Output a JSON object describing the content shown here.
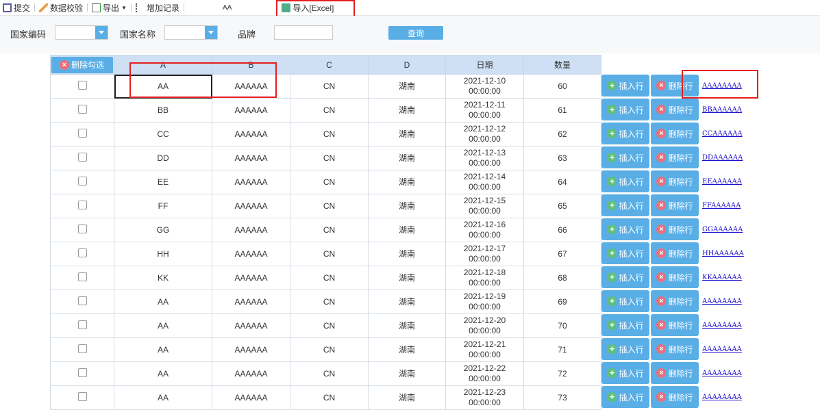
{
  "toolbar": {
    "submit": "提交",
    "validate": "数据校验",
    "export": "导出",
    "add_record": "增加记录",
    "aa": "AA",
    "import_excel": "导入[Excel]"
  },
  "filter": {
    "country_code_label": "国家编码",
    "country_name_label": "国家名称",
    "brand_label": "品牌",
    "query": "查询"
  },
  "table": {
    "delete_selected": "删除勾选",
    "columns": [
      "A",
      "B",
      "C",
      "D",
      "日期",
      "数量"
    ],
    "insert_label": "插入行",
    "delete_label": "删除行",
    "rows": [
      {
        "a": "AA",
        "b": "AAAAAA",
        "c": "CN",
        "d": "湖南",
        "date": "2021-12-10",
        "time": "00:00:00",
        "qty": "60",
        "link": "AAAAAAAA"
      },
      {
        "a": "BB",
        "b": "AAAAAA",
        "c": "CN",
        "d": "湖南",
        "date": "2021-12-11",
        "time": "00:00:00",
        "qty": "61",
        "link": "BBAAAAAA"
      },
      {
        "a": "CC",
        "b": "AAAAAA",
        "c": "CN",
        "d": "湖南",
        "date": "2021-12-12",
        "time": "00:00:00",
        "qty": "62",
        "link": "CCAAAAAA"
      },
      {
        "a": "DD",
        "b": "AAAAAA",
        "c": "CN",
        "d": "湖南",
        "date": "2021-12-13",
        "time": "00:00:00",
        "qty": "63",
        "link": "DDAAAAAA"
      },
      {
        "a": "EE",
        "b": "AAAAAA",
        "c": "CN",
        "d": "湖南",
        "date": "2021-12-14",
        "time": "00:00:00",
        "qty": "64",
        "link": "EEAAAAAA"
      },
      {
        "a": "FF",
        "b": "AAAAAA",
        "c": "CN",
        "d": "湖南",
        "date": "2021-12-15",
        "time": "00:00:00",
        "qty": "65",
        "link": "FFAAAAAA"
      },
      {
        "a": "GG",
        "b": "AAAAAA",
        "c": "CN",
        "d": "湖南",
        "date": "2021-12-16",
        "time": "00:00:00",
        "qty": "66",
        "link": "GGAAAAAA"
      },
      {
        "a": "HH",
        "b": "AAAAAA",
        "c": "CN",
        "d": "湖南",
        "date": "2021-12-17",
        "time": "00:00:00",
        "qty": "67",
        "link": "HHAAAAAA"
      },
      {
        "a": "KK",
        "b": "AAAAAA",
        "c": "CN",
        "d": "湖南",
        "date": "2021-12-18",
        "time": "00:00:00",
        "qty": "68",
        "link": "KKAAAAAA"
      },
      {
        "a": "AA",
        "b": "AAAAAA",
        "c": "CN",
        "d": "湖南",
        "date": "2021-12-19",
        "time": "00:00:00",
        "qty": "69",
        "link": "AAAAAAAA"
      },
      {
        "a": "AA",
        "b": "AAAAAA",
        "c": "CN",
        "d": "湖南",
        "date": "2021-12-20",
        "time": "00:00:00",
        "qty": "70",
        "link": "AAAAAAAA"
      },
      {
        "a": "AA",
        "b": "AAAAAA",
        "c": "CN",
        "d": "湖南",
        "date": "2021-12-21",
        "time": "00:00:00",
        "qty": "71",
        "link": "AAAAAAAA"
      },
      {
        "a": "AA",
        "b": "AAAAAA",
        "c": "CN",
        "d": "湖南",
        "date": "2021-12-22",
        "time": "00:00:00",
        "qty": "72",
        "link": "AAAAAAAA"
      },
      {
        "a": "AA",
        "b": "AAAAAA",
        "c": "CN",
        "d": "湖南",
        "date": "2021-12-23",
        "time": "00:00:00",
        "qty": "73",
        "link": "AAAAAAAA"
      }
    ]
  }
}
